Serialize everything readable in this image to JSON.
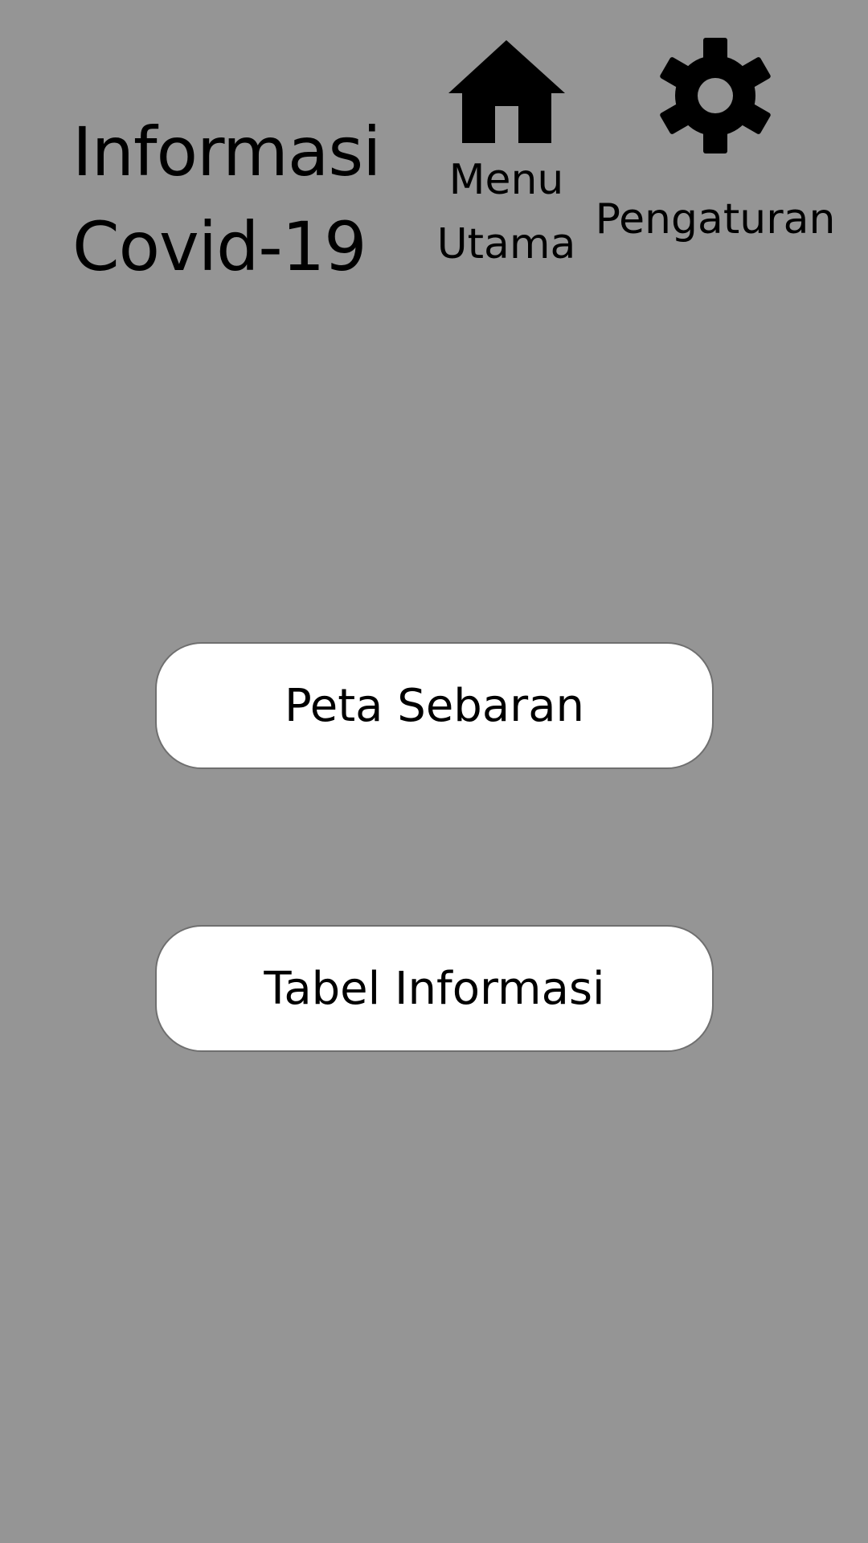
{
  "header": {
    "title_line1": "Informasi",
    "title_line2": "Covid-19"
  },
  "nav": {
    "home": {
      "icon": "home-icon",
      "label_line1": "Menu",
      "label_line2": "Utama"
    },
    "settings": {
      "icon": "gear-icon",
      "label": "Pengaturan"
    }
  },
  "main": {
    "buttons": [
      {
        "label": "Peta Sebaran"
      },
      {
        "label": "Tabel Informasi"
      }
    ]
  },
  "colors": {
    "background": "#959595",
    "button_bg": "#ffffff",
    "button_border": "#6f6f6f",
    "text": "#000000"
  }
}
